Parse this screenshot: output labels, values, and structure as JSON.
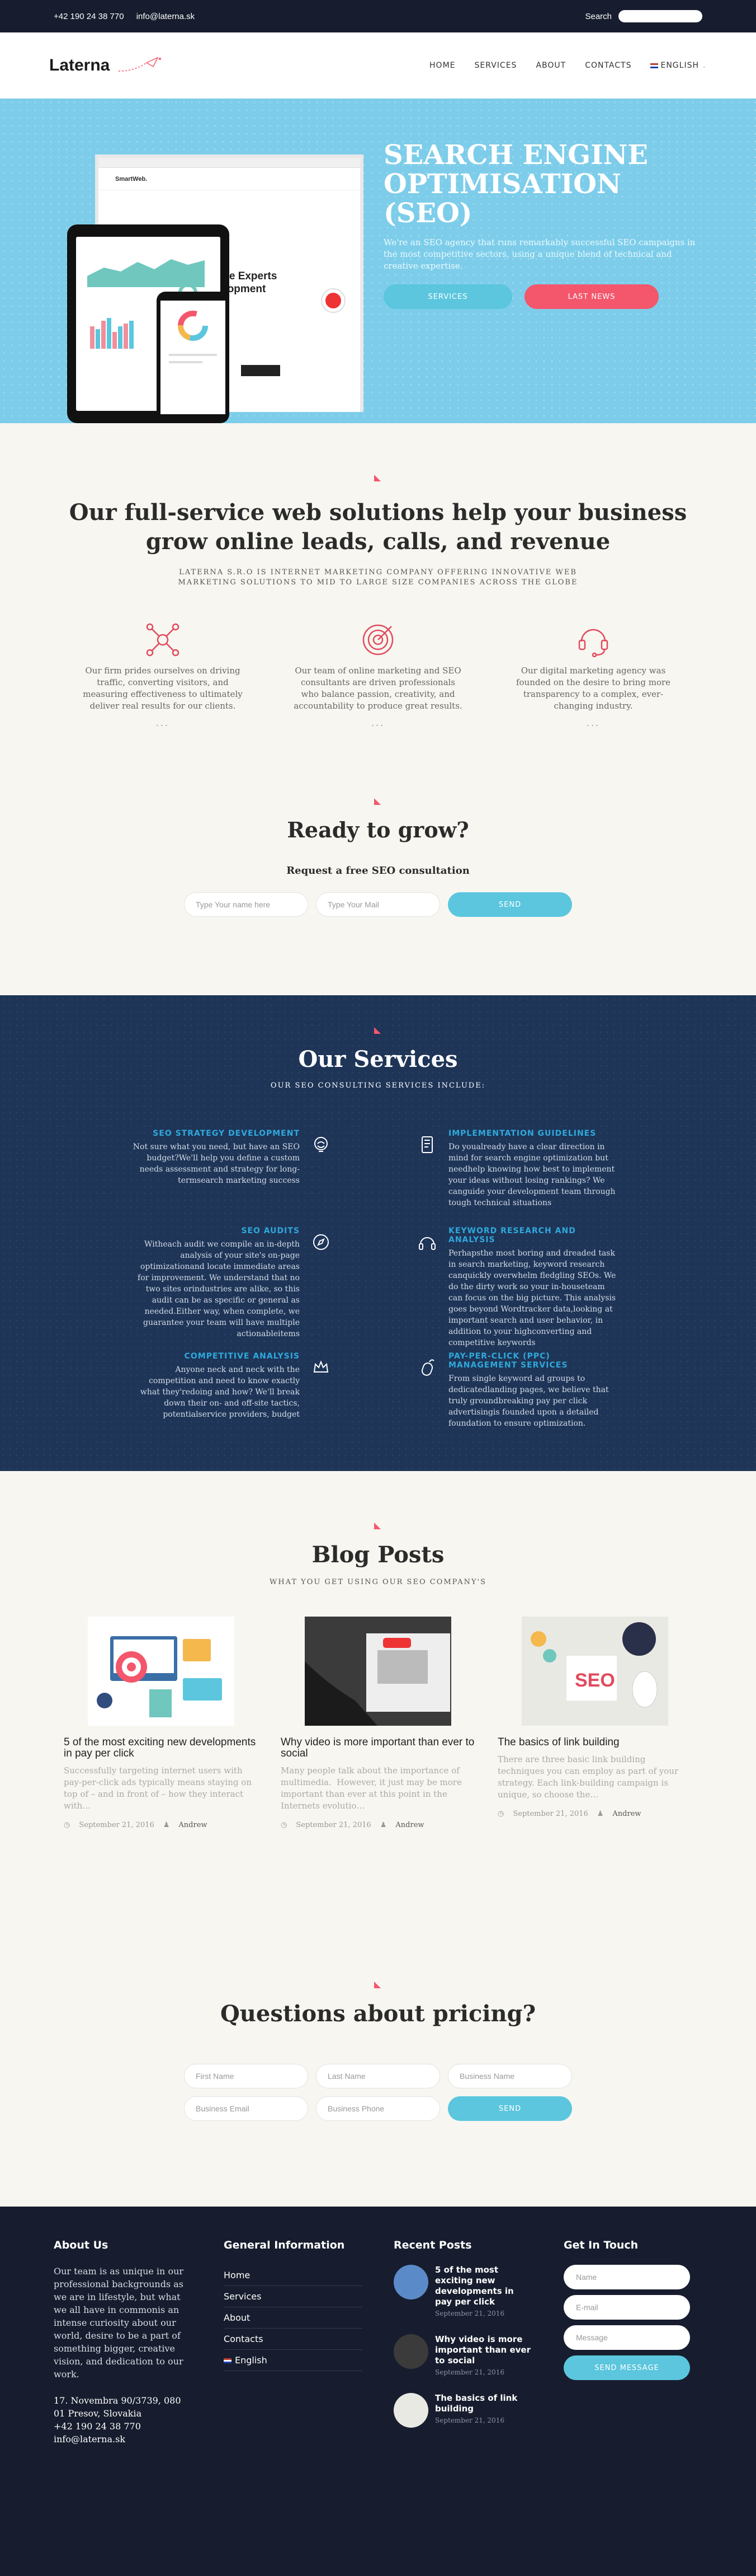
{
  "topbar": {
    "phone": "+42 190 24 38 770",
    "email": "info@laterna.sk",
    "search_label": "Search"
  },
  "nav": {
    "logo": "Laterna",
    "items": [
      "HOME",
      "SERVICES",
      "ABOUT",
      "CONTACTS"
    ],
    "language": "ENGLISH"
  },
  "hero": {
    "title": "SEARCH ENGINE OPTIMISATION (SEO)",
    "text": "We're an SEO agency that runs remarkably successful SEO campaigns in the most competitive sectors, using a unique blend of technical and creative expertise.",
    "btn_services": "SERVICES",
    "btn_news": "LAST NEWS",
    "mockup_brand": "SmartWeb.",
    "mockup_heading": "We Are Experts Development"
  },
  "intro": {
    "title": "Our full-service web solutions help your business grow online leads, calls, and revenue",
    "subtitle": "LATERNA S.R.O IS INTERNET MARKETING COMPANY OFFERING INNOVATIVE WEB MARKETING SOLUTIONS TO MID TO LARGE SIZE COMPANIES ACROSS THE GLOBE",
    "features": [
      {
        "icon": "network-icon",
        "text": "Our firm prides ourselves on driving traffic, converting visitors, and measuring effectiveness to ultimately deliver real results for our clients."
      },
      {
        "icon": "target-icon",
        "text": "Our team of online marketing and SEO consultants are driven professionals who balance passion, creativity, and accountability to produce great results."
      },
      {
        "icon": "headset-icon",
        "text": "Our digital marketing agency was founded on the desire to bring more transparency to a complex, ever-changing industry."
      }
    ],
    "more": "..."
  },
  "grow": {
    "title": "Ready to grow?",
    "subtitle": "Request a free SEO consultation",
    "name_placeholder": "Type Your name here",
    "mail_placeholder": "Type Your Mail",
    "send": "SEND"
  },
  "services": {
    "title": "Our Services",
    "subtitle": "OUR SEO CONSULTING SERVICES INCLUDE:",
    "items": [
      {
        "title": "SEO STRATEGY DEVELOPMENT",
        "text": "Not sure what you need, but have an SEO budget?We'll help you define a custom needs assessment and strategy for long-termsearch marketing success",
        "icon": "brain-icon"
      },
      {
        "title": "IMPLEMENTATION GUIDELINES",
        "text": "Do youalready have a clear direction in mind for search engine optimization but needhelp knowing how best to implement your ideas without losing rankings? We canguide your development team through tough technical situations",
        "icon": "document-icon"
      },
      {
        "title": "SEO AUDITS",
        "text": "Witheach audit we compile an in-depth analysis of your site's on-page optimizationand locate immediate areas for improvement. We understand that no two sites orindustries are alike, so this audit can be as specific or general as needed.Either way, when complete, we guarantee your team will have multiple actionableitems",
        "icon": "compass-icon"
      },
      {
        "title": "KEYWORD RESEARCH AND ANALYSIS",
        "text": "Perhapsthe most boring and dreaded task in search marketing, keyword research canquickly overwhelm fledgling SEOs. We do the dirty work so your in-houseteam can focus on the big picture. This analysis goes beyond Wordtracker data,looking at important search and user behavior, in addition to your highconverting and competitive keywords",
        "icon": "headphones-icon"
      },
      {
        "title": "COMPETITIVE ANALYSIS",
        "text": "Anyone neck and neck with the competition and need to know exactly what they'redoing and how? We'll break down their on- and off-site tactics, potentialservice providers, budget",
        "icon": "crown-icon"
      },
      {
        "title": "PAY-PER-CLICK (PPC) MANAGEMENT SERVICES",
        "text": "From single keyword ad groups to dedicatedlanding pages, we believe that truly groundbreaking pay per click advertisingis founded upon a detailed foundation to ensure optimization.",
        "icon": "mouse-icon"
      }
    ]
  },
  "blog": {
    "title": "Blog Posts",
    "subtitle": "WHAT YOU GET USING OUR SEO COMPANY'S",
    "posts": [
      {
        "title": "5 of the most exciting new developments in pay per click",
        "excerpt": "Successfully targeting internet users with pay-per-click ads typically means staying on top of – and in front of – how they interact with…",
        "date": "September 21, 2016",
        "author": "Andrew"
      },
      {
        "title": "Why video is more important than ever to social",
        "excerpt": "Many people talk about the importance of multimedia.  However, it just may be more important than ever at this point in the Internets evolutio…",
        "date": "September 21, 2016",
        "author": "Andrew"
      },
      {
        "title": "The basics of link building",
        "excerpt": "There are three basic link building techniques you can employ as part of your strategy. Each link-building campaign is unique, so choose the…",
        "date": "September 21, 2016",
        "author": "Andrew"
      }
    ]
  },
  "pricing": {
    "title": "Questions about pricing?",
    "first_name": "First Name",
    "last_name": "Last Name",
    "business_name": "Business Name",
    "business_email": "Business Email",
    "business_phone": "Business Phone",
    "send": "SEND"
  },
  "footer": {
    "about_title": "About Us",
    "about_text": "Our team is as unique in our professional backgrounds as we are in lifestyle, but what we all have in commonis an intense curiosity about our world, desire to be a part of something bigger, creative vision, and dedication to our work.",
    "address1": "17. Novembra 90/3739, 080 01 Presov, Slovakia",
    "phone": "+42 190 24 38 770",
    "email": "info@laterna.sk",
    "info_title": "General Information",
    "links": [
      "Home",
      "Services",
      "About",
      "Contacts",
      "English"
    ],
    "recent_title": "Recent Posts",
    "recent": [
      {
        "title": "5 of the most exciting new developments in pay per click",
        "date": "September 21, 2016"
      },
      {
        "title": "Why video is more important than ever to social",
        "date": "September 21, 2016"
      },
      {
        "title": "The basics of link building",
        "date": "September 21, 2016"
      }
    ],
    "touch_title": "Get In Touch",
    "name_ph": "Name",
    "email_ph": "E-mail",
    "message_ph": "Message",
    "send": "SEND MESSAGE"
  },
  "colors": {
    "accent_blue": "#5bc6de",
    "accent_red": "#f4566c",
    "dark_navy": "#171d2e",
    "hero_blue": "#7dcdea"
  }
}
